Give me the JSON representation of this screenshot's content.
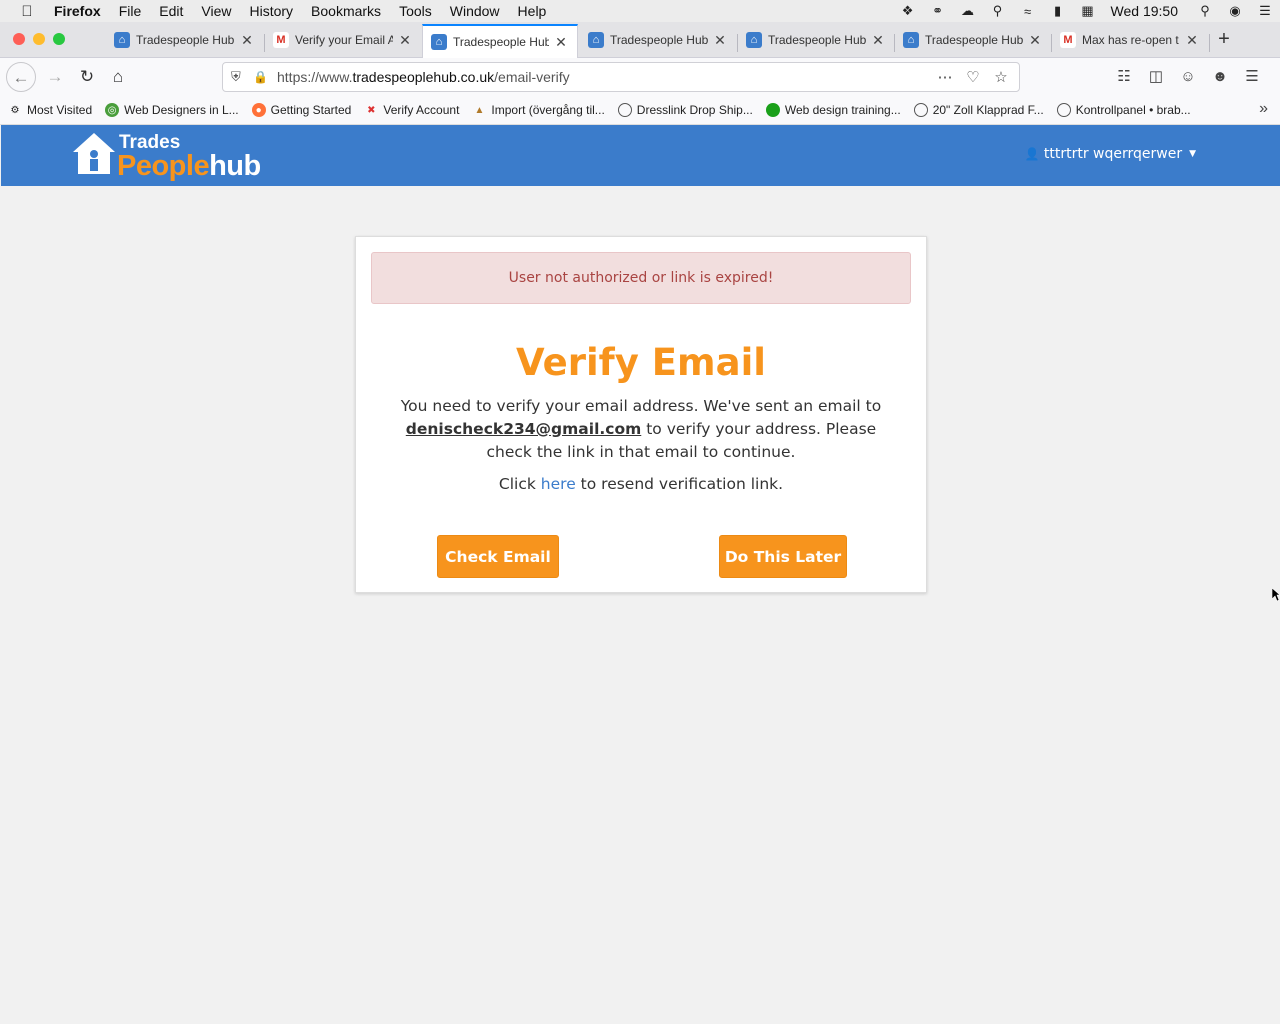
{
  "menubar": {
    "app": "Firefox",
    "items": [
      "File",
      "Edit",
      "View",
      "History",
      "Bookmarks",
      "Tools",
      "Window",
      "Help"
    ],
    "clock": "Wed 19:50"
  },
  "tabs": [
    {
      "title": "Tradespeople Hub",
      "icon": "tradespeople-favicon",
      "active": false
    },
    {
      "title": "Verify your Email A",
      "icon": "gmail-favicon",
      "active": false
    },
    {
      "title": "Tradespeople Hub",
      "icon": "tradespeople-favicon",
      "active": true
    },
    {
      "title": "Tradespeople Hub",
      "icon": "tradespeople-favicon",
      "active": false
    },
    {
      "title": "Tradespeople Hub",
      "icon": "tradespeople-favicon",
      "active": false
    },
    {
      "title": "Tradespeople Hub",
      "icon": "tradespeople-favicon",
      "active": false
    },
    {
      "title": "Max has re-open t",
      "icon": "gmail-favicon",
      "active": false
    }
  ],
  "urlbar": {
    "prefix": "https://www.",
    "domain": "tradespeoplehub.co.uk",
    "path": "/email-verify"
  },
  "bookmarks": [
    {
      "label": "Most Visited",
      "icon": "gear-icon"
    },
    {
      "label": "Web Designers in L...",
      "icon": "globe-green-icon"
    },
    {
      "label": "Getting Started",
      "icon": "firefox-icon"
    },
    {
      "label": "Verify Account",
      "icon": "tools-icon"
    },
    {
      "label": "Import (övergång til...",
      "icon": "bottle-icon"
    },
    {
      "label": "Dresslink Drop Ship...",
      "icon": "globe-icon"
    },
    {
      "label": "Web design training...",
      "icon": "green-dot-icon"
    },
    {
      "label": "20\" Zoll Klapprad F...",
      "icon": "globe-icon"
    },
    {
      "label": "Kontrollpanel • brab...",
      "icon": "globe-icon"
    }
  ],
  "site": {
    "logo_top": "Trades",
    "logo_people": "People",
    "logo_hub": "hub",
    "user_name": "tttrtrtr wqerrqerwer",
    "brand_blue": "#3b7ccb",
    "brand_orange": "#f7941d"
  },
  "verify": {
    "alert": "User not authorized or link is expired!",
    "title": "Verify Email",
    "text_before": "You need to verify your email address. We've sent an email to",
    "email": "denischeck234@gmail.com",
    "text_after": "to verify your address. Please check the link in that email to continue.",
    "resend_before": "Click",
    "resend_link": "here",
    "resend_after": "to resend verification link.",
    "check_button": "Check Email",
    "later_button": "Do This Later"
  }
}
